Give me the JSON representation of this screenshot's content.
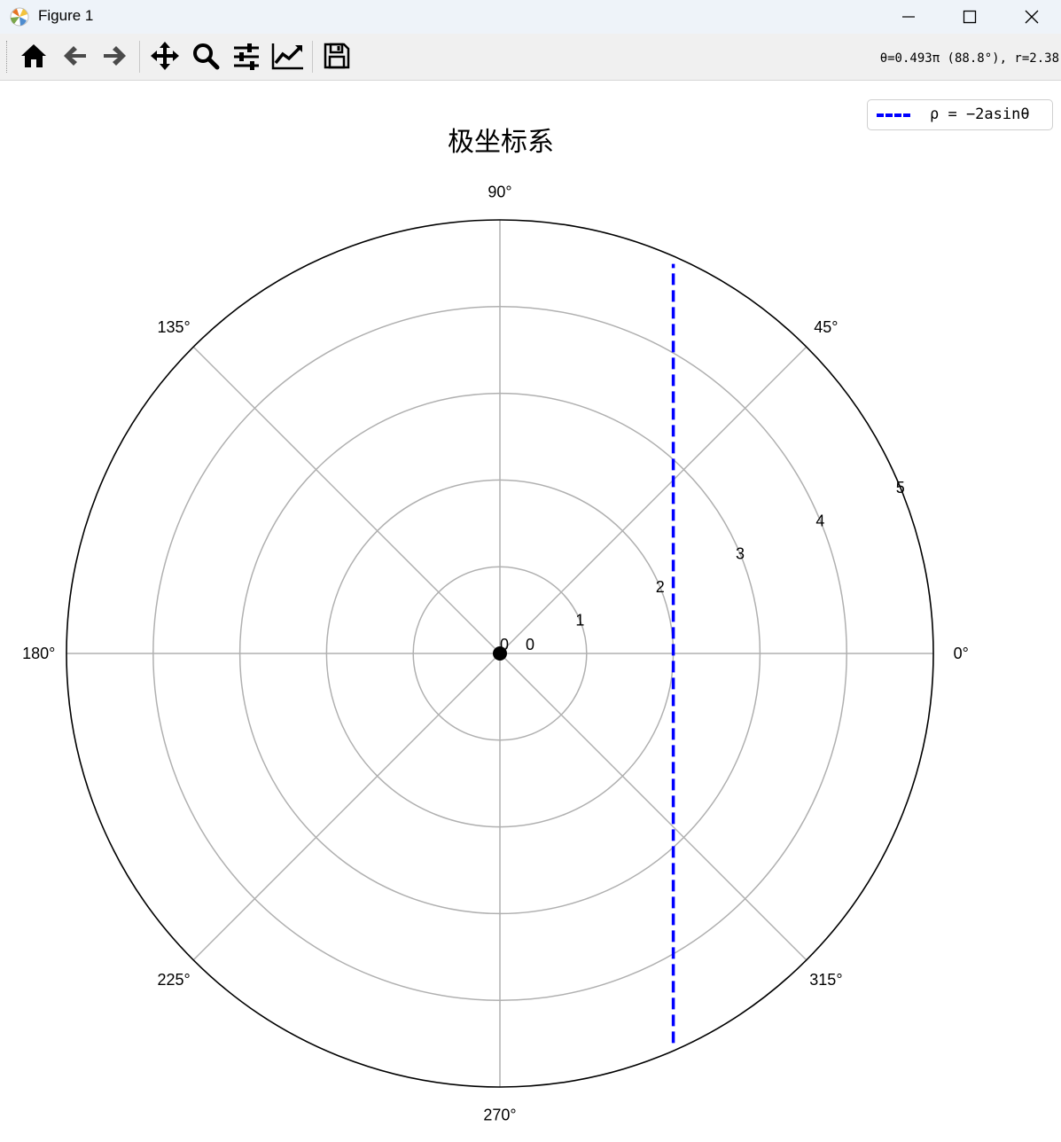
{
  "window": {
    "title": "Figure 1"
  },
  "toolbar": {
    "buttons": [
      {
        "name": "home-button",
        "icon": "home-icon"
      },
      {
        "name": "back-button",
        "icon": "arrow-left-icon"
      },
      {
        "name": "forward-button",
        "icon": "arrow-right-icon"
      },
      {
        "name": "pan-button",
        "icon": "move-icon"
      },
      {
        "name": "zoom-button",
        "icon": "magnifier-icon"
      },
      {
        "name": "configure-subplots-button",
        "icon": "sliders-icon"
      },
      {
        "name": "edit-axes-button",
        "icon": "line-chart-icon"
      },
      {
        "name": "save-button",
        "icon": "floppy-disk-icon"
      }
    ],
    "coordinate_readout": "θ=0.493π (88.8°), r=2.38"
  },
  "chart_data": {
    "type": "line",
    "projection": "polar",
    "title": "极坐标系",
    "angle_tick_labels": [
      "0°",
      "45°",
      "90°",
      "135°",
      "180°",
      "225°",
      "270°",
      "315°"
    ],
    "angle_ticks_deg": [
      0,
      45,
      90,
      135,
      180,
      225,
      270,
      315
    ],
    "radial_tick_labels": [
      "0",
      "1",
      "2",
      "3",
      "4",
      "5"
    ],
    "radial_ticks": [
      0,
      1,
      2,
      3,
      4,
      5
    ],
    "rlim": [
      0,
      5
    ],
    "grid": true,
    "legend_placement": "top-right",
    "origin_label": "0",
    "series": [
      {
        "name": "ρ = −2asinθ",
        "color": "#0000ff",
        "linestyle": "dashed",
        "x_constant": 2,
        "theta_range_deg": [
          -76,
          76
        ]
      }
    ],
    "points": [
      {
        "r": 0,
        "theta_deg": 0,
        "color": "#000000"
      }
    ]
  }
}
